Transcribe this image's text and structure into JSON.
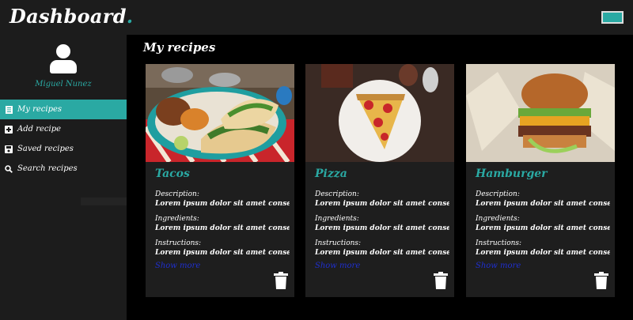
{
  "header": {
    "brand": "Dashboard",
    "brand_dot": ".",
    "menu_icon": "menu-icon"
  },
  "sidebar": {
    "user_icon": "user-icon",
    "username": "Miguel Nunez",
    "items": [
      {
        "label": "My recipes",
        "icon": "list-icon",
        "active": true
      },
      {
        "label": "Add recipe",
        "icon": "plus-square-icon",
        "active": false
      },
      {
        "label": "Saved recipes",
        "icon": "save-icon",
        "active": false
      },
      {
        "label": "Search recipes",
        "icon": "search-icon",
        "active": false
      }
    ]
  },
  "main": {
    "title": "My recipes",
    "cards": [
      {
        "title": "Tacos",
        "description_label": "Description:",
        "description": "Lorem ipsum dolor sit amet consec...",
        "ingredients_label": "Ingredients:",
        "ingredients": "Lorem ipsum dolor sit amet consec...",
        "instructions_label": "Instructions:",
        "instructions": "Lorem ipsum dolor sit amet consec...",
        "show_more": "Show more",
        "delete_icon": "trash-icon"
      },
      {
        "title": "Pizza",
        "description_label": "Description:",
        "description": "Lorem ipsum dolor sit amet consec...",
        "ingredients_label": "Ingredients:",
        "ingredients": "Lorem ipsum dolor sit amet consec...",
        "instructions_label": "Instructions:",
        "instructions": "Lorem ipsum dolor sit amet consec...",
        "show_more": "Show more",
        "delete_icon": "trash-icon"
      },
      {
        "title": "Hamburger",
        "description_label": "Description:",
        "description": "Lorem ipsum dolor sit amet consec...",
        "ingredients_label": "Ingredients:",
        "ingredients": "Lorem ipsum dolor sit amet consec...",
        "instructions_label": "Instructions:",
        "instructions": "Lorem ipsum dolor sit amet consec...",
        "show_more": "Show more",
        "delete_icon": "trash-icon"
      }
    ]
  },
  "colors": {
    "accent": "#2aa9a3",
    "link": "#1f2fd0",
    "background": "#000000",
    "panel": "#1c1c1c"
  }
}
